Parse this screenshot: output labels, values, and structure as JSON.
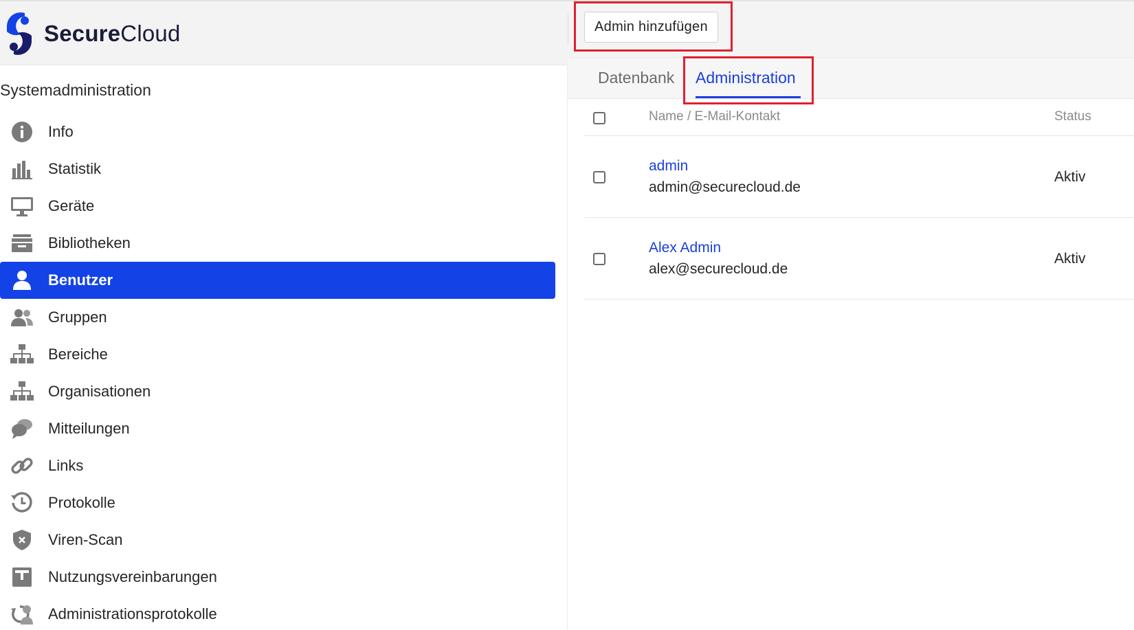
{
  "app": {
    "logo_text_bold": "Secure",
    "logo_text_regular": "Cloud",
    "brand_color": "#1343e6"
  },
  "sidebar": {
    "section_title": "Systemadministration",
    "items": [
      {
        "label": "Info",
        "icon": "info-icon",
        "active": false
      },
      {
        "label": "Statistik",
        "icon": "bar-chart-icon",
        "active": false
      },
      {
        "label": "Geräte",
        "icon": "monitor-icon",
        "active": false
      },
      {
        "label": "Bibliotheken",
        "icon": "archive-icon",
        "active": false
      },
      {
        "label": "Benutzer",
        "icon": "user-icon",
        "active": true
      },
      {
        "label": "Gruppen",
        "icon": "users-icon",
        "active": false
      },
      {
        "label": "Bereiche",
        "icon": "sitemap-icon",
        "active": false
      },
      {
        "label": "Organisationen",
        "icon": "sitemap-icon",
        "active": false
      },
      {
        "label": "Mitteilungen",
        "icon": "comments-icon",
        "active": false
      },
      {
        "label": "Links",
        "icon": "link-icon",
        "active": false
      },
      {
        "label": "Protokolle",
        "icon": "history-icon",
        "active": false
      },
      {
        "label": "Viren-Scan",
        "icon": "shield-x-icon",
        "active": false
      },
      {
        "label": "Nutzungsvereinbarungen",
        "icon": "agreement-icon",
        "active": false
      },
      {
        "label": "Administrationsprotokolle",
        "icon": "admin-log-icon",
        "active": false
      }
    ]
  },
  "toolbar": {
    "add_admin_label": "Admin hinzufügen"
  },
  "tabs": [
    {
      "label": "Datenbank",
      "active": false
    },
    {
      "label": "Administration",
      "active": true
    }
  ],
  "table": {
    "headers": {
      "name": "Name / E-Mail-Kontakt",
      "status": "Status"
    },
    "rows": [
      {
        "name": "admin",
        "email": "admin@securecloud.de",
        "status": "Aktiv"
      },
      {
        "name": "Alex Admin",
        "email": "alex@securecloud.de",
        "status": "Aktiv"
      }
    ]
  },
  "highlight_color": "#e0202e"
}
